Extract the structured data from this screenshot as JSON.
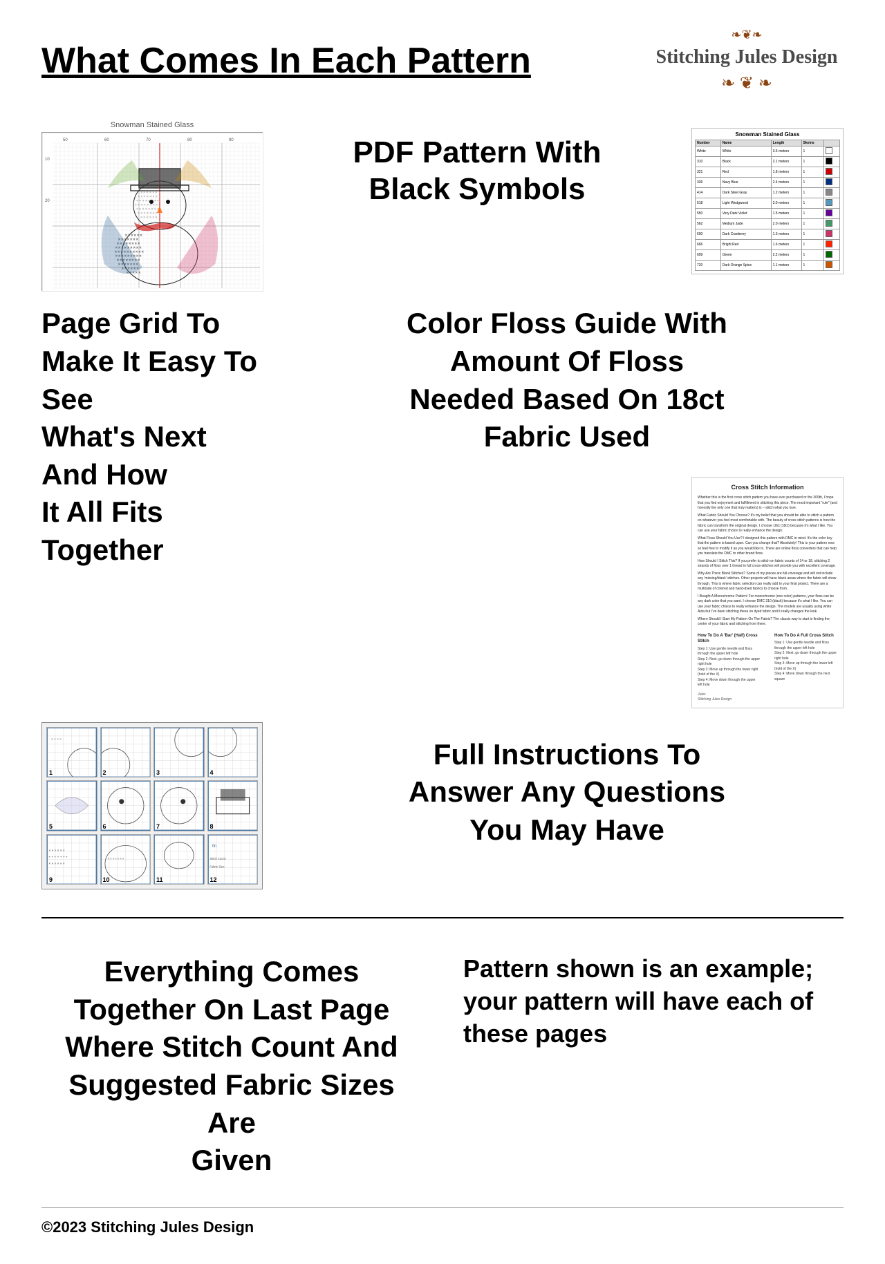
{
  "header": {
    "title": "What Comes In Each Pattern",
    "logo_name": "Stitching Jules Design",
    "logo_decoration": "❧ ❦ ❧"
  },
  "sections": {
    "pdf_pattern": {
      "title": "PDF Pattern With\nBlack Symbols",
      "preview_label": "Snowman Stained Glass"
    },
    "color_floss": {
      "title": "Color Floss Guide With\nAmount Of Floss\nNeeded Based On 18ct\nFabric Used"
    },
    "page_grid": {
      "title": "Page Grid To\nMake It Easy To See\nWhat's Next And How\nIt All Fits Together"
    },
    "instructions": {
      "title": "Full Instructions To\nAnswer Any Questions\nYou May Have"
    },
    "everything": {
      "title": "Everything Comes\nTogether On Last Page\nWhere Stitch Count And\nSuggested Fabric Sizes Are\nGiven"
    },
    "example_note": {
      "text": "Pattern shown is an example; your pattern will have each of these pages"
    }
  },
  "floss_table": {
    "title": "Snowman Stained Glass",
    "headers": [
      "Number",
      "Name",
      "Length",
      "Skeins"
    ],
    "rows": [
      {
        "number": "White",
        "name": "White",
        "length": "3.5 meters",
        "skeins": "1",
        "color": "#ffffff"
      },
      {
        "number": "310",
        "name": "Black",
        "length": "2.1 meters",
        "skeins": "1",
        "color": "#000000"
      },
      {
        "number": "321",
        "name": "Red",
        "length": "1.8 meters",
        "skeins": "1",
        "color": "#cc0000"
      },
      {
        "number": "336",
        "name": "Navy Blue",
        "length": "2.4 meters",
        "skeins": "1",
        "color": "#003080"
      },
      {
        "number": "414",
        "name": "Dark Steel Gray",
        "length": "1.2 meters",
        "skeins": "1",
        "color": "#888888"
      },
      {
        "number": "518",
        "name": "Light Wedgwood",
        "length": "3.0 meters",
        "skeins": "1",
        "color": "#5599bb"
      },
      {
        "number": "550",
        "name": "Very Dark Violet",
        "length": "1.5 meters",
        "skeins": "1",
        "color": "#660099"
      },
      {
        "number": "562",
        "name": "Medium Jade",
        "length": "2.0 meters",
        "skeins": "1",
        "color": "#449966"
      },
      {
        "number": "600",
        "name": "Dark Cranberry",
        "length": "1.3 meters",
        "skeins": "1",
        "color": "#cc3366"
      },
      {
        "number": "666",
        "name": "Bright Red",
        "length": "1.6 meters",
        "skeins": "1",
        "color": "#ff2200"
      },
      {
        "number": "699",
        "name": "Green",
        "length": "2.2 meters",
        "skeins": "1",
        "color": "#006600"
      },
      {
        "number": "720",
        "name": "Dark Orange Spice",
        "length": "1.1 meters",
        "skeins": "1",
        "color": "#cc5500"
      }
    ]
  },
  "cross_stitch_info": {
    "title": "Cross Stitch Information",
    "paragraphs": [
      "Whether this is the first cross stitch pattern you have ever purchased or the 300th, I hope that you find enjoyment and fulfillment in stitching this piece. The most important \"rule\" (and honestly the only one that truly matters) is – stitch what you love.",
      "What Fabric Should You Choose? It's my belief that you should be able to stitch a pattern on whatever you feel most comfortable with. The beauty of cross stitch patterns is how the fabric can transform the original design. I choose 18ct (18ct) because it's what I like. You can use your fabric choice to really enhance the design.",
      "What Floss Should You Use? I designed this pattern with DMC in mind. It's the color key that the pattern is based upon. Can you change that? Absolutely! This is your pattern now so feel free to modify it as you would like to. There are online floss converters that can help you translate the DMC to other brand floss.",
      "How Should I Stitch This? If you prefer to stitch on fabric counts of 14 or 18, stitching 2 strands of floss over 1 thread in full cross-stitches will provide you with excellent coverage.",
      "Why Are There Blank Stitches? Some of my pieces are full-coverage and will not include any 'missing/blank' stitches. Other projects will have blank areas where the fabric will show through. This is where fabric selection can really add to your final project. There are a multitude of colored and hand-dyed fabrics to choose from.",
      "I Bought A Monochrome Pattern! For monochrome (one color) patterns, your floss can be any dark color that you want. I choose DMC 310 (black) because it's what I like. You can use your fabric choice to really enhance the design. The models are usually using white Aida but I've been stitching these on dyed fabric and it really changes the look.",
      "Where Should I Start My Pattern On The Fabric? The classic way to start is finding the center of your fabric and stitching from there."
    ]
  },
  "grid_pages": {
    "items": [
      {
        "num": "1"
      },
      {
        "num": "2"
      },
      {
        "num": "3"
      },
      {
        "num": "4"
      },
      {
        "num": "5"
      },
      {
        "num": "6"
      },
      {
        "num": "7"
      },
      {
        "num": "8"
      },
      {
        "num": "9"
      },
      {
        "num": "10"
      },
      {
        "num": "11"
      },
      {
        "num": "12"
      }
    ]
  },
  "footer": {
    "text": "©2023 Stitching Jules Design"
  }
}
